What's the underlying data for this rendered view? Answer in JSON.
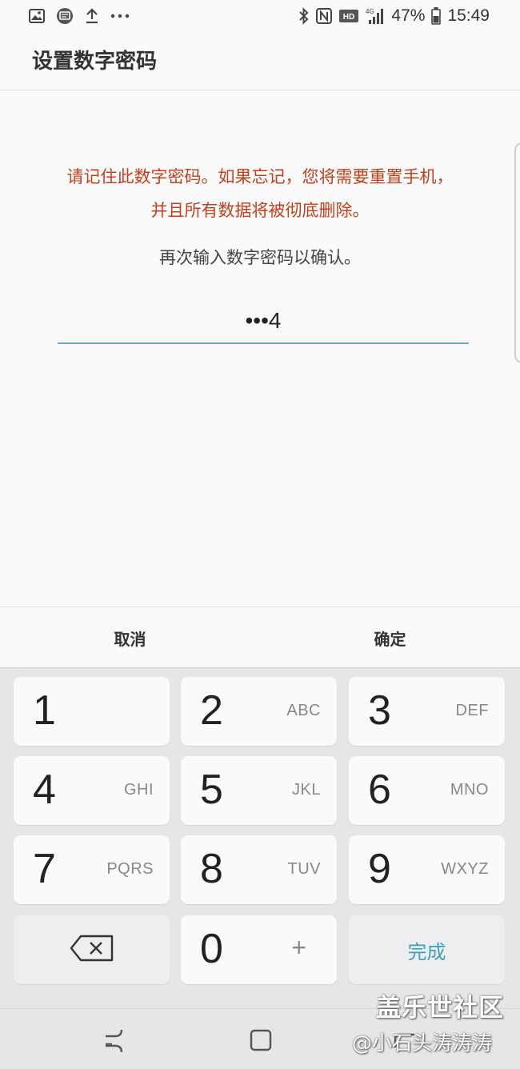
{
  "status_bar": {
    "icons_left": [
      "gallery-icon",
      "cast-icon",
      "upload-icon",
      "more-icon"
    ],
    "icons_right": [
      "bluetooth-icon",
      "nfc-icon",
      "hd-voice-icon",
      "signal-icon",
      "battery-icon"
    ],
    "hd_label": "HD",
    "network": "4G",
    "battery": "47%",
    "time": "15:49"
  },
  "header": {
    "title": "设置数字密码"
  },
  "content": {
    "warning_line1": "请记住此数字密码。如果忘记，您将需要重置手机，",
    "warning_line2": "并且所有数据将被彻底删除。",
    "prompt": "再次输入数字密码以确认。",
    "pin_value": "•••4"
  },
  "actions": {
    "cancel": "取消",
    "confirm": "确定"
  },
  "keypad": {
    "keys": [
      {
        "num": "1",
        "letters": ""
      },
      {
        "num": "2",
        "letters": "ABC"
      },
      {
        "num": "3",
        "letters": "DEF"
      },
      {
        "num": "4",
        "letters": "GHI"
      },
      {
        "num": "5",
        "letters": "JKL"
      },
      {
        "num": "6",
        "letters": "MNO"
      },
      {
        "num": "7",
        "letters": "PQRS"
      },
      {
        "num": "8",
        "letters": "TUV"
      },
      {
        "num": "9",
        "letters": "WXYZ"
      }
    ],
    "zero": "0",
    "plus": "+",
    "done": "完成"
  },
  "watermark": {
    "site": "盖乐世社区",
    "author": "@小石头涛涛涛"
  },
  "colors": {
    "warning": "#c4401c",
    "accent": "#3aa2c0",
    "keypad_bg": "#e6e6e8"
  }
}
